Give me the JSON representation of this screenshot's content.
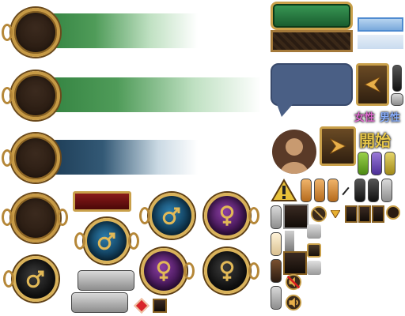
{
  "labels": {
    "female": "女性",
    "male": "男性",
    "start": "開始"
  },
  "icons": [
    "male-symbol-icon",
    "female-symbol-icon",
    "arrow-left-icon",
    "arrow-right-icon",
    "warning-icon",
    "no-entry-icon",
    "down-triangle-icon",
    "speaker-icon",
    "mute-icon",
    "avatar-icon"
  ],
  "colors": {
    "gold": "#c79a45",
    "green_bar": "#30803e",
    "blue_bar": "#193750",
    "blue_orb": "#2c7aa8",
    "purple_orb": "#8a3fa3",
    "bubble": "#4a5f85",
    "female_text": "#c040b0",
    "male_text": "#4a78d0"
  }
}
